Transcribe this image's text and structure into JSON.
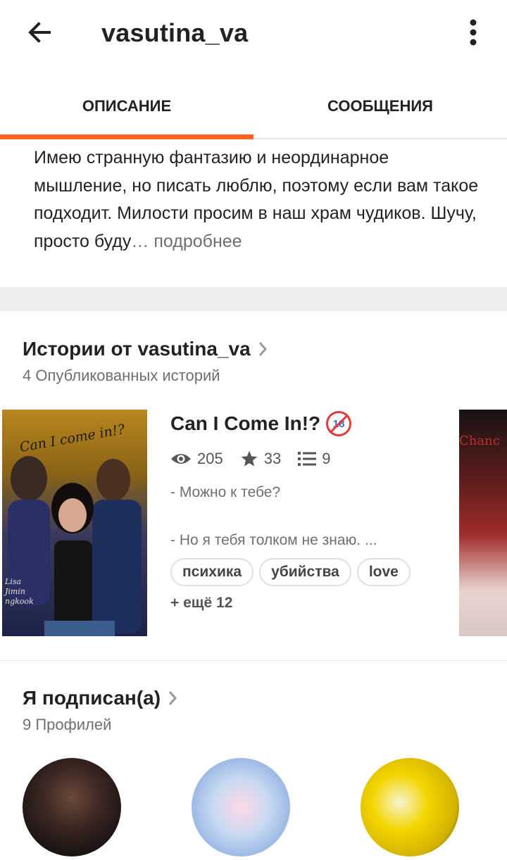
{
  "header": {
    "title": "vasutina_va",
    "back_icon": "arrow-left-icon",
    "more_icon": "more-vertical-icon"
  },
  "tabs": [
    {
      "label": "ОПИСАНИЕ",
      "active": true
    },
    {
      "label": "СООБЩЕНИЯ",
      "active": false
    }
  ],
  "accent_color": "#ff6122",
  "description": {
    "text": "Имею странную фантазию и неординарное мышление, но писать люблю, поэтому если вам такое подходит. Милости просим в наш храм чудиков. Шучу, просто буду",
    "ellipsis": "…",
    "more_label": "подробнее"
  },
  "stories_section": {
    "title": "Истории от vasutina_va",
    "subtitle": "4 Опубликованных историй",
    "story": {
      "title": "Can I Come In!?",
      "age_badge": "18",
      "cover_text": "Can I come in!?",
      "cover_names": "Lisa Jimin ngkook",
      "peek_cover_text": "Chanc",
      "views": "205",
      "stars": "33",
      "parts": "9",
      "blurb_line1": "- Можно к тебе?",
      "blurb_line2": "- Но я тебя толком не знаю. ...",
      "tags": [
        "психика",
        "убийства",
        "love"
      ],
      "more_tags": "+ ещё 12"
    }
  },
  "following_section": {
    "title": "Я подписан(а)",
    "subtitle": "9 Профилей"
  }
}
